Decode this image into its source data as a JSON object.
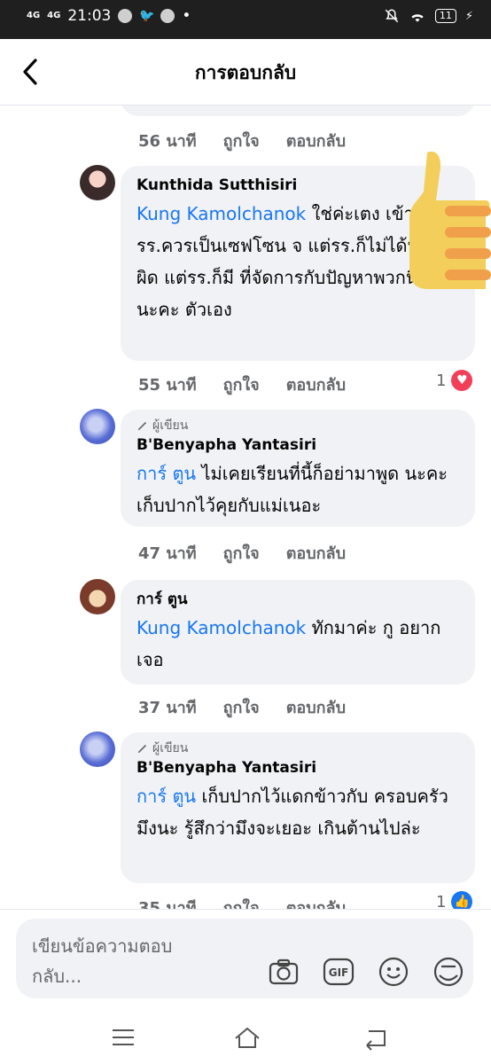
{
  "status": {
    "network_1": "4G",
    "network_2": "4G",
    "time": "21:03",
    "battery": "11"
  },
  "header": {
    "title": "การตอบกลับ"
  },
  "comments": [
    {
      "meta": {
        "time": "56 นาที",
        "like": "ถูกใจ",
        "reply": "ตอบกลับ"
      }
    },
    {
      "author": "Kunthida Sutthisiri",
      "mention": "Kung Kamolchanok",
      "text": " ใช่ค่ะเตง เข้าใจแต่รร.ควรเป็นเซฟโซน จ แต่รร.ก็ไม่ได้นร.ก็ผิด แต่รร.ก็มี ที่จัดการกับปัญหาพวกนี้ไม่ได้นะคะ ตัวเอง",
      "meta": {
        "time": "55 นาที",
        "like": "ถูกใจ",
        "reply": "ตอบกลับ"
      },
      "reaction_count": "1"
    },
    {
      "badge": "ผู้เขียน",
      "author": "B'Benyapha Yantasiri",
      "mention": "การ์ ตูน",
      "text": " ไม่เคยเรียนที่นี้ก็อย่ามาพูด นะคะ เก็บปากไว้คุยกับแม่เนอะ",
      "meta": {
        "time": "47 นาที",
        "like": "ถูกใจ",
        "reply": "ตอบกลับ"
      }
    },
    {
      "author": "การ์ ตูน",
      "mention": "Kung Kamolchanok",
      "text": " ทักมาค่ะ กู อยากเจอ",
      "meta": {
        "time": "37 นาที",
        "like": "ถูกใจ",
        "reply": "ตอบกลับ"
      }
    },
    {
      "badge": "ผู้เขียน",
      "author": "B'Benyapha Yantasiri",
      "mention": "การ์ ตูน",
      "text": " เก็บปากไว้แดกข้าวกับ ครอบครัวมึงนะ รู้สึกว่ามึงจะเยอะ เกินต้านไปล่ะ",
      "meta": {
        "time": "35 นาที",
        "like": "ถูกใจ",
        "reply": "ตอบกลับ"
      },
      "reaction_count": "1"
    }
  ],
  "composer": {
    "placeholder": "เขียนข้อความตอบกลับ..."
  },
  "colors": {
    "accent": "#1877f2",
    "bubble": "#f0f2f5",
    "love": "#f33e58"
  }
}
